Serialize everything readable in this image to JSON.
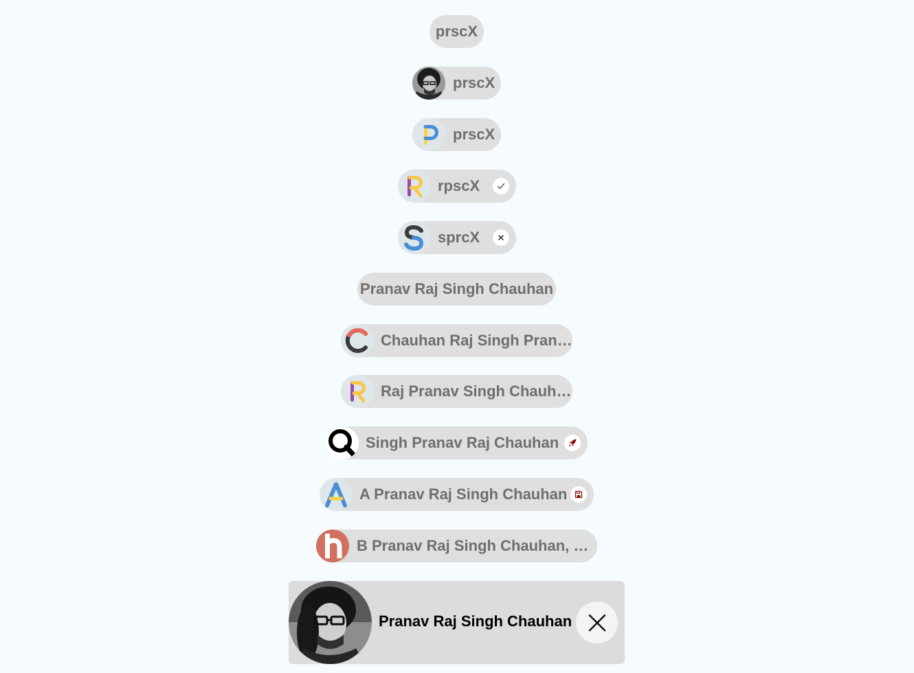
{
  "chips": [
    {
      "label": "prscX"
    },
    {
      "label": "prscX",
      "avatar": "portrait-photo"
    },
    {
      "label": "prscX",
      "avatar": "letter-p-logo"
    },
    {
      "label": "rpscX",
      "avatar": "letter-r-logo",
      "action": "checkmark-icon"
    },
    {
      "label": "sprcX",
      "avatar": "letter-s-logo",
      "action": "close-icon"
    },
    {
      "label": "Pranav Raj Singh Chauhan"
    },
    {
      "label": "Chauhan Raj Singh Pranav",
      "avatar": "letter-c-logo"
    },
    {
      "label": "Raj Pranav Singh Chauhan",
      "avatar": "letter-r-logo"
    },
    {
      "label": "Singh Pranav Raj Chauhan",
      "avatar": "letter-q-logo",
      "action": "rocket-icon"
    },
    {
      "label": "A Pranav Raj Singh Chauhan",
      "avatar": "letter-a-logo",
      "action": "save-icon"
    },
    {
      "label": "B Pranav Raj Singh Chauhan, Pr...",
      "avatar": "letter-b-logo"
    }
  ],
  "big_chip": {
    "label": "Pranav Raj Singh Chauhan",
    "avatar": "portrait-photo",
    "action": "close-icon"
  },
  "colors": {
    "page_background": "#f5fbfe",
    "chip_background": "#dfdfdf",
    "chip_text": "#6e6e6e",
    "rocket_red": "#8b0a0a"
  }
}
